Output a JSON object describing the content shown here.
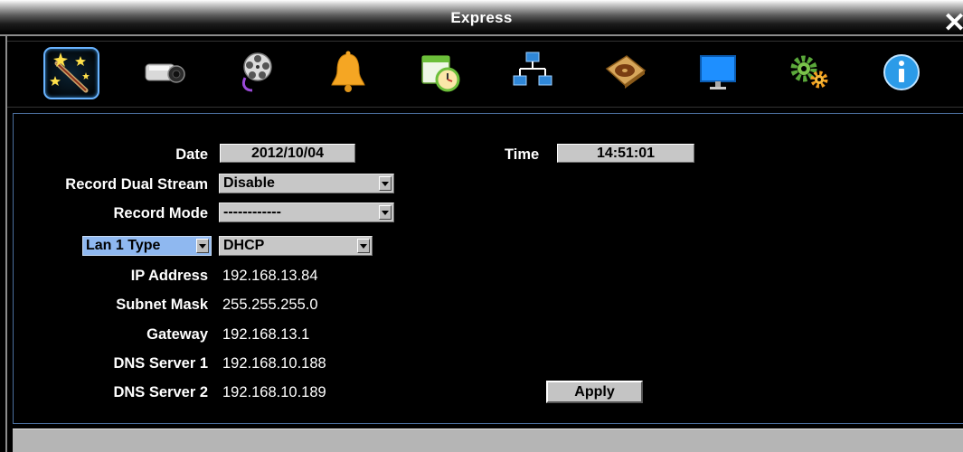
{
  "window": {
    "title": "Express",
    "close_symbol": "✕"
  },
  "toolbar": {
    "items": [
      {
        "name": "express-wizard",
        "icon": "wand-icon",
        "selected": true
      },
      {
        "name": "camera",
        "icon": "camera-icon"
      },
      {
        "name": "record",
        "icon": "film-reel-icon"
      },
      {
        "name": "event",
        "icon": "bell-icon"
      },
      {
        "name": "schedule",
        "icon": "calendar-clock-icon"
      },
      {
        "name": "network",
        "icon": "network-icon"
      },
      {
        "name": "disk",
        "icon": "hard-disk-icon"
      },
      {
        "name": "display",
        "icon": "monitor-icon"
      },
      {
        "name": "system",
        "icon": "gears-icon"
      },
      {
        "name": "info",
        "icon": "info-icon"
      }
    ]
  },
  "form": {
    "date_label": "Date",
    "date_value": "2012/10/04",
    "time_label": "Time",
    "time_value": "14:51:01",
    "dual_stream_label": "Record Dual Stream",
    "dual_stream_value": "Disable",
    "record_mode_label": "Record Mode",
    "record_mode_value": "------------",
    "lan_type_label": "Lan 1 Type",
    "lan_type_value": "DHCP",
    "ip_label": "IP Address",
    "ip_value": "192.168.13.84",
    "subnet_label": "Subnet Mask",
    "subnet_value": "255.255.255.0",
    "gateway_label": "Gateway",
    "gateway_value": "192.168.13.1",
    "dns1_label": "DNS Server 1",
    "dns1_value": "192.168.10.188",
    "dns2_label": "DNS Server 2",
    "dns2_value": "192.168.10.189",
    "apply_label": "Apply"
  },
  "colors": {
    "accent": "#4b6f9e",
    "selection": "#8fb8f0",
    "field": "#c7c7c7"
  }
}
